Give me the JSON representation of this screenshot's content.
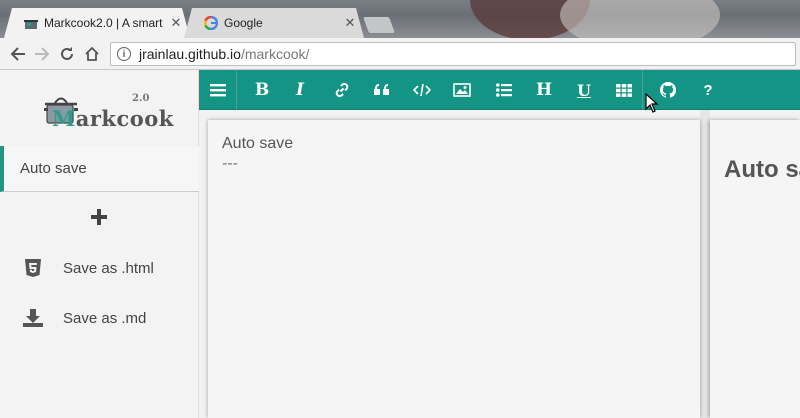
{
  "browser": {
    "tabs": [
      {
        "title": "Markcook2.0 | A smart",
        "active": true
      },
      {
        "title": "Google",
        "active": false
      }
    ],
    "address": {
      "domain": "jrainlau.github.io",
      "path": "/markcook/"
    }
  },
  "logo": {
    "word_first": "M",
    "word_rest": "arkcook",
    "version": "2.0"
  },
  "sidebar": {
    "active_item": "Auto save",
    "actions": [
      {
        "label": "Save as .html",
        "icon": "html5-icon"
      },
      {
        "label": "Save as .md",
        "icon": "download-icon"
      }
    ]
  },
  "toolbar": {
    "buttons": [
      "menu",
      "bold",
      "italic",
      "link",
      "quote",
      "code",
      "image",
      "list",
      "heading",
      "underline",
      "table",
      "github",
      "help"
    ],
    "heading_label": "H",
    "underline_label": "U",
    "bold_label": "B",
    "italic_label": "I",
    "help_label": "?",
    "color": "#149485"
  },
  "editor": {
    "line1": "Auto save",
    "line2": "---"
  },
  "preview": {
    "heading": "Auto save"
  }
}
